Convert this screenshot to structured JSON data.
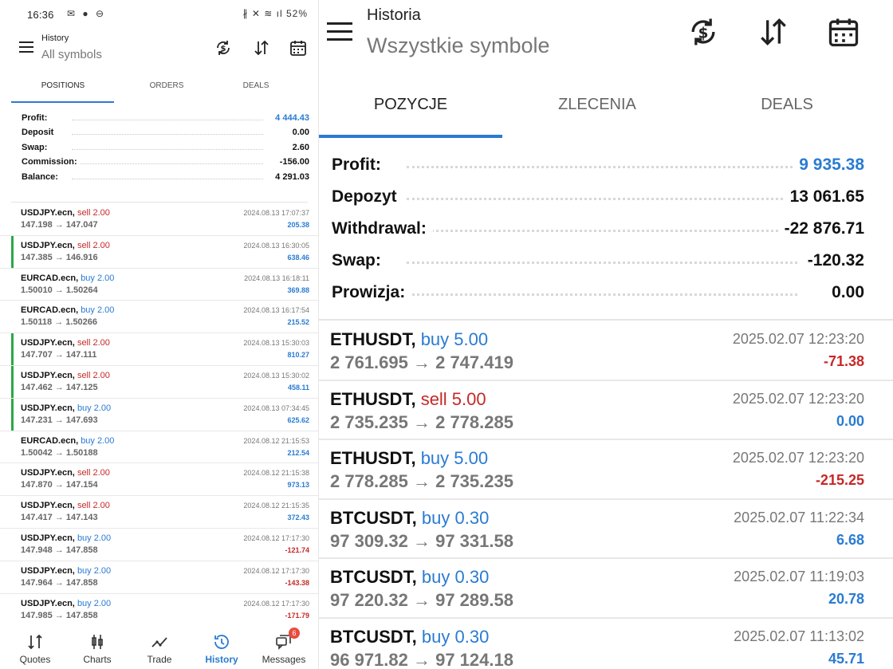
{
  "colors": {
    "accent": "#2a7bd3",
    "buy": "#2a7bd3",
    "sell": "#c62828",
    "positive": "#2a7bd3",
    "negative": "#c62828",
    "open_marker": "#2aa845"
  },
  "left": {
    "status": {
      "time": "16:36",
      "battery": "52%",
      "icons_left": "✉ ● ⊖",
      "icons_right": "∦ ✕ ≋ ıl"
    },
    "header": {
      "title": "History",
      "subtitle": "All symbols",
      "icons": [
        "currency-exchange-icon",
        "sort-icon",
        "calendar-icon"
      ]
    },
    "tabs": [
      "POSITIONS",
      "ORDERS",
      "DEALS"
    ],
    "summary": [
      {
        "label": "Profit:",
        "value": "4 444.43",
        "color": "blue"
      },
      {
        "label": "Deposit",
        "value": "0.00",
        "color": "dark"
      },
      {
        "label": "Swap:",
        "value": "2.60",
        "color": "dark"
      },
      {
        "label": "Commission:",
        "value": "-156.00",
        "color": "dark"
      },
      {
        "label": "Balance:",
        "value": "4 291.03",
        "color": "dark"
      }
    ],
    "deals": [
      {
        "symbol": "USDJPY.ecn,",
        "side": "sell 2.00",
        "side_color": "red",
        "price": "147.198 → 147.047",
        "datetime": "2024.08.13 17:07:37",
        "profit": "205.38",
        "profit_color": "blue",
        "marker": false
      },
      {
        "symbol": "USDJPY.ecn,",
        "side": "sell 2.00",
        "side_color": "red",
        "price": "147.385 → 146.916",
        "datetime": "2024.08.13 16:30:05",
        "profit": "638.46",
        "profit_color": "blue",
        "marker": true
      },
      {
        "symbol": "EURCAD.ecn,",
        "side": "buy 2.00",
        "side_color": "blue",
        "price": "1.50010 → 1.50264",
        "datetime": "2024.08.13 16:18:11",
        "profit": "369.88",
        "profit_color": "blue",
        "marker": false
      },
      {
        "symbol": "EURCAD.ecn,",
        "side": "buy 2.00",
        "side_color": "blue",
        "price": "1.50118 → 1.50266",
        "datetime": "2024.08.13 16:17:54",
        "profit": "215.52",
        "profit_color": "blue",
        "marker": false
      },
      {
        "symbol": "USDJPY.ecn,",
        "side": "sell 2.00",
        "side_color": "red",
        "price": "147.707 → 147.111",
        "datetime": "2024.08.13 15:30:03",
        "profit": "810.27",
        "profit_color": "blue",
        "marker": true
      },
      {
        "symbol": "USDJPY.ecn,",
        "side": "sell 2.00",
        "side_color": "red",
        "price": "147.462 → 147.125",
        "datetime": "2024.08.13 15:30:02",
        "profit": "458.11",
        "profit_color": "blue",
        "marker": true
      },
      {
        "symbol": "USDJPY.ecn,",
        "side": "buy 2.00",
        "side_color": "blue",
        "price": "147.231 → 147.693",
        "datetime": "2024.08.13 07:34:45",
        "profit": "625.62",
        "profit_color": "blue",
        "marker": true
      },
      {
        "symbol": "EURCAD.ecn,",
        "side": "buy 2.00",
        "side_color": "blue",
        "price": "1.50042 → 1.50188",
        "datetime": "2024.08.12 21:15:53",
        "profit": "212.54",
        "profit_color": "blue",
        "marker": false
      },
      {
        "symbol": "USDJPY.ecn,",
        "side": "sell 2.00",
        "side_color": "red",
        "price": "147.870 → 147.154",
        "datetime": "2024.08.12 21:15:38",
        "profit": "973.13",
        "profit_color": "blue",
        "marker": false
      },
      {
        "symbol": "USDJPY.ecn,",
        "side": "sell 2.00",
        "side_color": "red",
        "price": "147.417 → 147.143",
        "datetime": "2024.08.12 21:15:35",
        "profit": "372.43",
        "profit_color": "blue",
        "marker": false
      },
      {
        "symbol": "USDJPY.ecn,",
        "side": "buy 2.00",
        "side_color": "blue",
        "price": "147.948 → 147.858",
        "datetime": "2024.08.12 17:17:30",
        "profit": "-121.74",
        "profit_color": "red",
        "marker": false
      },
      {
        "symbol": "USDJPY.ecn,",
        "side": "buy 2.00",
        "side_color": "blue",
        "price": "147.964 → 147.858",
        "datetime": "2024.08.12 17:17:30",
        "profit": "-143.38",
        "profit_color": "red",
        "marker": false
      },
      {
        "symbol": "USDJPY.ecn,",
        "side": "buy 2.00",
        "side_color": "blue",
        "price": "147.985 → 147.858",
        "datetime": "2024.08.12 17:17:30",
        "profit": "-171.79",
        "profit_color": "red",
        "marker": false
      }
    ],
    "nav": [
      {
        "label": "Quotes",
        "icon": "quotes-icon",
        "active": false
      },
      {
        "label": "Charts",
        "icon": "charts-icon",
        "active": false
      },
      {
        "label": "Trade",
        "icon": "trade-icon",
        "active": false
      },
      {
        "label": "History",
        "icon": "history-icon",
        "active": true
      },
      {
        "label": "Messages",
        "icon": "messages-icon",
        "active": false,
        "badge": "6"
      }
    ]
  },
  "right": {
    "header": {
      "title": "Historia",
      "subtitle": "Wszystkie symbole",
      "icons": [
        "currency-exchange-icon",
        "sort-icon",
        "calendar-icon"
      ]
    },
    "tabs": [
      "POZYCJE",
      "ZLECENIA",
      "DEALS"
    ],
    "summary": [
      {
        "label": "Profit:",
        "value": "9 935.38",
        "color": "blue"
      },
      {
        "label": "Depozyt",
        "value": "13 061.65",
        "color": "dark"
      },
      {
        "label": "Withdrawal:",
        "value": "-22 876.71",
        "color": "dark"
      },
      {
        "label": "Swap:",
        "value": "-120.32",
        "color": "dark"
      },
      {
        "label": "Prowizja:",
        "value": "0.00",
        "color": "dark"
      }
    ],
    "deals": [
      {
        "symbol": "ETHUSDT,",
        "side": "buy 5.00",
        "side_color": "blue",
        "price": "2 761.695 → 2 747.419",
        "datetime": "2025.02.07 12:23:20",
        "profit": "-71.38",
        "profit_color": "red"
      },
      {
        "symbol": "ETHUSDT,",
        "side": "sell 5.00",
        "side_color": "red",
        "price": "2 735.235 → 2 778.285",
        "datetime": "2025.02.07 12:23:20",
        "profit": "0.00",
        "profit_color": "blue"
      },
      {
        "symbol": "ETHUSDT,",
        "side": "buy 5.00",
        "side_color": "blue",
        "price": "2 778.285 → 2 735.235",
        "datetime": "2025.02.07 12:23:20",
        "profit": "-215.25",
        "profit_color": "red"
      },
      {
        "symbol": "BTCUSDT,",
        "side": "buy 0.30",
        "side_color": "blue",
        "price": "97 309.32 → 97 331.58",
        "datetime": "2025.02.07 11:22:34",
        "profit": "6.68",
        "profit_color": "blue"
      },
      {
        "symbol": "BTCUSDT,",
        "side": "buy 0.30",
        "side_color": "blue",
        "price": "97 220.32 → 97 289.58",
        "datetime": "2025.02.07 11:19:03",
        "profit": "20.78",
        "profit_color": "blue"
      },
      {
        "symbol": "BTCUSDT,",
        "side": "buy 0.30",
        "side_color": "blue",
        "price": "96 971.82 → 97 124.18",
        "datetime": "2025.02.07 11:13:02",
        "profit": "45.71",
        "profit_color": "blue"
      }
    ]
  }
}
